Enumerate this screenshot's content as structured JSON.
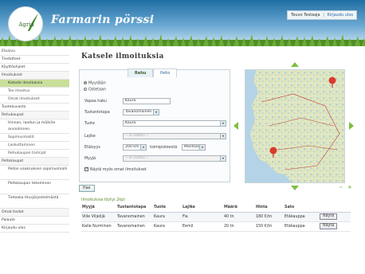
{
  "header": {
    "logo_text": "Agria",
    "app_title": "Farmarin pörssi",
    "user_name": "Teuvo Testaaja",
    "separator": "|",
    "logout": "Kirjaudu ulos"
  },
  "sidebar": {
    "items": [
      {
        "label": "Etusivu"
      },
      {
        "label": "Tiedotteet"
      },
      {
        "label": "Käyttöohjeet"
      },
      {
        "label": "Ilmoitukset"
      },
      {
        "label": "Katsele ilmoituksia"
      },
      {
        "label": "Tee ilmoitus"
      },
      {
        "label": "Omat ilmoitukset"
      },
      {
        "label": "Tuotekuvasto"
      },
      {
        "label": "Rehukaupat"
      },
      {
        "label": "Hinnan, laadun ja määrän arvioiminen"
      },
      {
        "label": "Sopimusmallit"
      },
      {
        "label": "Laskuttaminen"
      },
      {
        "label": "Rehukaupan toimijat"
      },
      {
        "label": "Peltokaupat"
      },
      {
        "label": "Pellon vaaksuksen sopimusmalli"
      },
      {
        "label": "Peltokaupan tekeminen"
      },
      {
        "label": "Tietoeka tilusjärjestelmästä"
      },
      {
        "label": "Omat tiedot"
      },
      {
        "label": "Palaute"
      },
      {
        "label": "Kirjaudu ulos"
      }
    ]
  },
  "main": {
    "title": "Katsele ilmoituksia",
    "tabs": [
      {
        "label": "Rehu"
      },
      {
        "label": "Pelto"
      }
    ],
    "radios": [
      {
        "label": "Myydään"
      },
      {
        "label": "Ostetaan"
      }
    ],
    "form": {
      "quick_search_label": "Vapaa haku",
      "quick_search_value": "Kaura",
      "product_form_label": "Tuotantotapa",
      "product_form_value": "Tavanomainen",
      "product_label": "Tuote",
      "product_value": "Kaura",
      "variety_label": "Lajike",
      "variety_value": "-- ei valittu --",
      "distance_label": "Etäisyys",
      "distance_value": "200 km",
      "distance_unit": "toimipisteestä",
      "location_value": "Mäntsälä",
      "seller_label": "Myyjä",
      "seller_value": "-- ei valittu --",
      "show_own_label": "Näytä myös omat ilmoitukset",
      "search_button": "Hae"
    }
  },
  "map": {
    "zoom_out": "–",
    "zoom_in": "+",
    "markers": [
      {
        "name": "marker-1",
        "color": "#d93a2c"
      },
      {
        "name": "marker-2",
        "color": "#d93a2c"
      }
    ]
  },
  "results": {
    "title": "Ilmoituksia löytyi 2kpl",
    "columns": [
      "Myyjä",
      "Tuotantotapa",
      "Tuote",
      "Lajike",
      "Määrä",
      "Hinta",
      "Sato",
      ""
    ],
    "rows": [
      {
        "seller": "Ville Viljelijä",
        "production": "Tavanomainen",
        "product": "Kaura",
        "variety": "Fia",
        "amount": "40 tn",
        "price": "180 €/tn",
        "harvest": "Etäkauppa",
        "action": "Näytä"
      },
      {
        "seller": "Kalle Nurminen",
        "production": "Tavanomainen",
        "product": "Kaura",
        "variety": "Eemil",
        "amount": "20 tn",
        "price": "150 €/tn",
        "harvest": "Etäkauppa",
        "action": "Näytä"
      }
    ]
  },
  "colors": {
    "accent_green": "#7fbe3d",
    "header_blue": "#1f6ea3",
    "active_nav": "#c9df9a"
  }
}
